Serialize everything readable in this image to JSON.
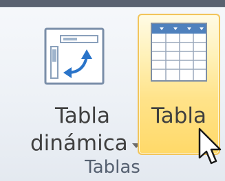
{
  "ribbon_group": {
    "label": "Tablas",
    "buttons": [
      {
        "label_line1": "Tabla",
        "label_line2": "dinámica",
        "icon": "pivot-table-icon",
        "has_dropdown": true
      },
      {
        "label": "Tabla",
        "icon": "table-icon",
        "state": "hover"
      }
    ]
  },
  "colors": {
    "hover_border": "#f2c45a",
    "hover_fill": "#ffe38a",
    "table_header": "#4f81bd"
  },
  "cursor": "arrow-pointer-icon"
}
